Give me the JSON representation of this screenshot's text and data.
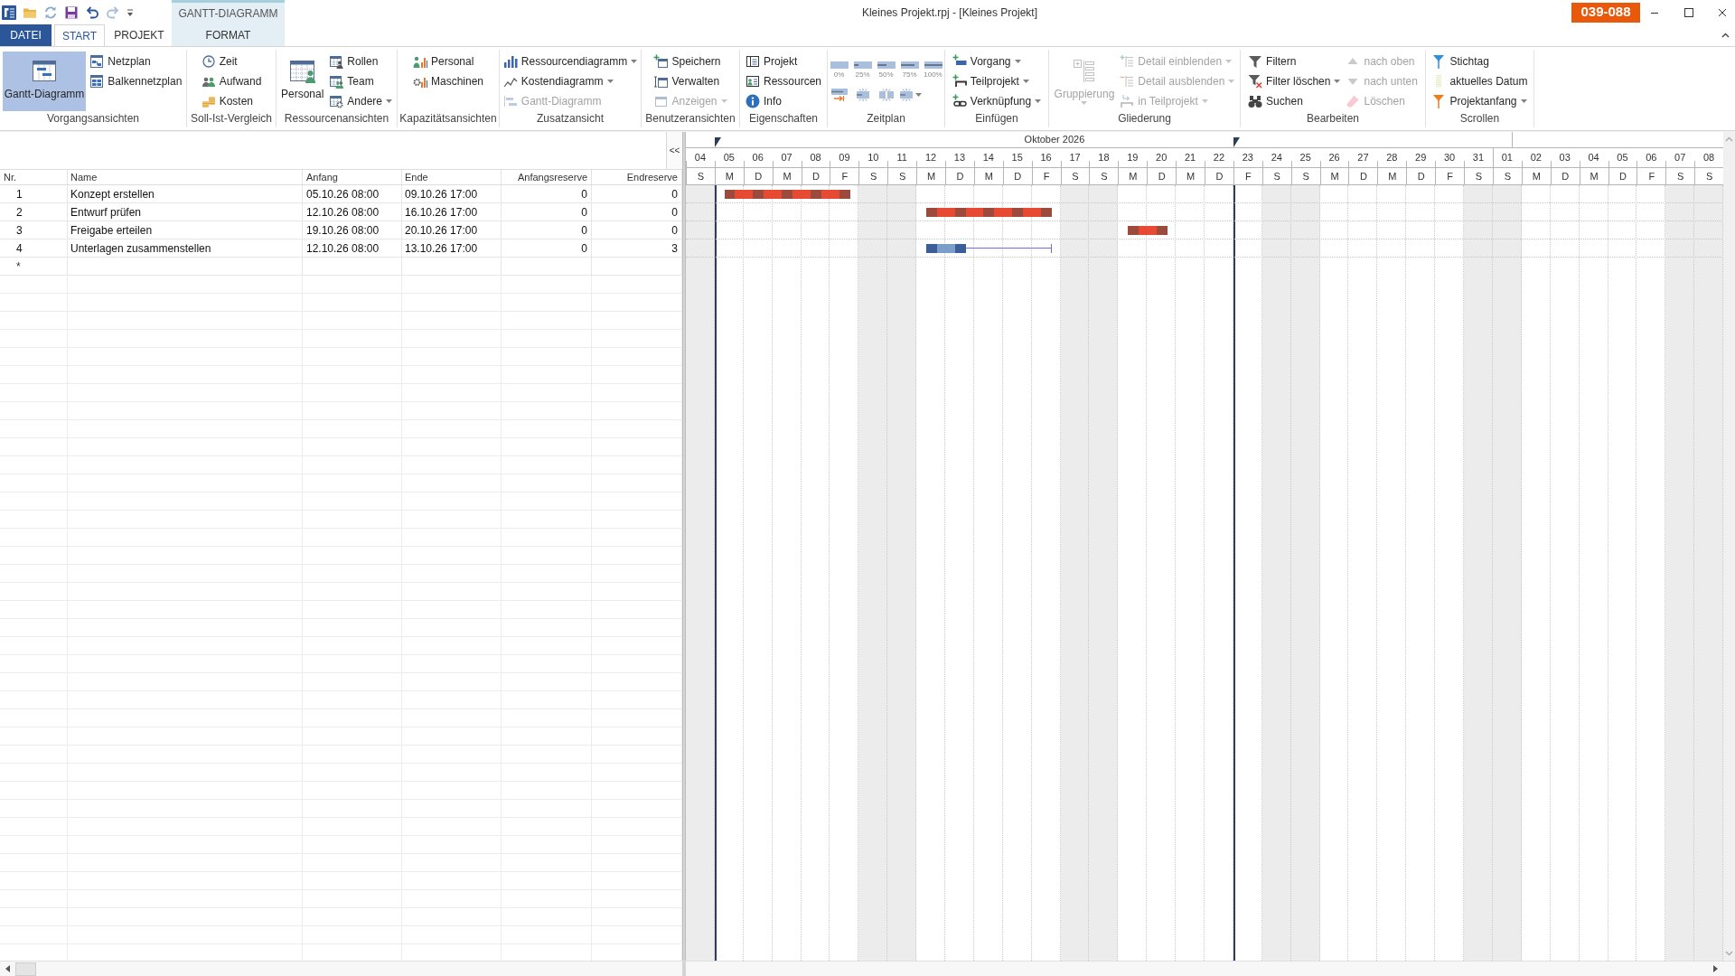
{
  "title_bar": {
    "context_tab_group": "GANTT-DIAGRAMM",
    "title": "Kleines Projekt.rpj - [Kleines Projekt]",
    "badge": "039-088"
  },
  "ribbon_tabs": [
    {
      "label": "DATEI",
      "kind": "file",
      "selected": false
    },
    {
      "label": "START",
      "kind": "tab",
      "selected": true
    },
    {
      "label": "PROJEKT",
      "kind": "tab",
      "selected": false
    },
    {
      "label": "FORMAT",
      "kind": "context",
      "selected": false
    }
  ],
  "ribbon_groups": [
    {
      "label": "Vorgangsansichten",
      "columns": [
        [
          {
            "label": "Gantt-Diagramm",
            "kind": "large",
            "selected": true,
            "disabled": false,
            "dropdown": false
          }
        ],
        [
          {
            "label": "Netzplan",
            "kind": "small",
            "selected": false,
            "disabled": false,
            "dropdown": false
          },
          {
            "label": "Balkennetzplan",
            "kind": "small",
            "selected": false,
            "disabled": false,
            "dropdown": false
          }
        ]
      ]
    },
    {
      "label": "Soll-Ist-Vergleich",
      "columns": [
        [
          {
            "label": "Zeit",
            "kind": "small",
            "disabled": false,
            "dropdown": false
          },
          {
            "label": "Aufwand",
            "kind": "small",
            "disabled": false,
            "dropdown": false
          },
          {
            "label": "Kosten",
            "kind": "small",
            "disabled": false,
            "dropdown": false
          }
        ]
      ]
    },
    {
      "label": "Ressourcenansichten",
      "columns": [
        [
          {
            "label": "Personal",
            "kind": "large",
            "disabled": false,
            "dropdown": false
          }
        ],
        [
          {
            "label": "Rollen",
            "kind": "small",
            "disabled": false,
            "dropdown": false
          },
          {
            "label": "Team",
            "kind": "small",
            "disabled": false,
            "dropdown": false
          },
          {
            "label": "Andere",
            "kind": "small",
            "disabled": false,
            "dropdown": true
          }
        ]
      ]
    },
    {
      "label": "Kapazitätsansichten",
      "columns": [
        [
          {
            "label": "Personal",
            "kind": "small",
            "disabled": false,
            "dropdown": false
          },
          {
            "label": "Maschinen",
            "kind": "small",
            "disabled": false,
            "dropdown": false
          }
        ]
      ]
    },
    {
      "label": "Zusatzansicht",
      "columns": [
        [
          {
            "label": "Ressourcendiagramm",
            "kind": "small",
            "disabled": false,
            "dropdown": true
          },
          {
            "label": "Kostendiagramm",
            "kind": "small",
            "disabled": false,
            "dropdown": true
          },
          {
            "label": "Gantt-Diagramm",
            "kind": "small",
            "disabled": true,
            "dropdown": false
          }
        ]
      ]
    },
    {
      "label": "Benutzeransichten",
      "columns": [
        [
          {
            "label": "Speichern",
            "kind": "small",
            "disabled": false,
            "dropdown": false
          },
          {
            "label": "Verwalten",
            "kind": "small",
            "disabled": false,
            "dropdown": false
          },
          {
            "label": "Anzeigen",
            "kind": "small",
            "disabled": true,
            "dropdown": true
          }
        ]
      ]
    },
    {
      "label": "Eigenschaften",
      "columns": [
        [
          {
            "label": "Projekt",
            "kind": "small",
            "disabled": false,
            "dropdown": false
          },
          {
            "label": "Ressourcen",
            "kind": "small",
            "disabled": false,
            "dropdown": false
          },
          {
            "label": "Info",
            "kind": "small",
            "disabled": false,
            "dropdown": false
          }
        ]
      ]
    },
    {
      "label": "Zeitplan",
      "columns": [
        [
          {
            "label": "0%",
            "kind": "percent",
            "disabled": false,
            "dropdown": false
          },
          {
            "kind": "icon",
            "disabled": false,
            "dropdown": false
          }
        ],
        [
          {
            "label": "25%",
            "kind": "percent",
            "disabled": false,
            "dropdown": false
          },
          {
            "kind": "icon",
            "disabled": false,
            "dropdown": false
          }
        ],
        [
          {
            "label": "50%",
            "kind": "percent",
            "disabled": false,
            "dropdown": false
          },
          {
            "kind": "icon",
            "disabled": false,
            "dropdown": false
          }
        ],
        [
          {
            "label": "75%",
            "kind": "percent",
            "disabled": false,
            "dropdown": false
          },
          {
            "kind": "icon",
            "disabled": false,
            "dropdown": true
          }
        ],
        [
          {
            "label": "100%",
            "kind": "percent",
            "disabled": false,
            "dropdown": false
          }
        ]
      ]
    },
    {
      "label": "Einfügen",
      "columns": [
        [
          {
            "label": "Vorgang",
            "kind": "small",
            "disabled": false,
            "dropdown": true
          },
          {
            "label": "Teilprojekt",
            "kind": "small",
            "disabled": false,
            "dropdown": true
          },
          {
            "label": "Verknüpfung",
            "kind": "small",
            "disabled": false,
            "dropdown": true
          }
        ]
      ]
    },
    {
      "label": "Gliederung",
      "columns": [
        [
          {
            "label": "Gruppierung",
            "kind": "large",
            "disabled": true,
            "dropdown": true
          }
        ],
        [
          {
            "label": "Detail einblenden",
            "kind": "small",
            "disabled": true,
            "dropdown": true
          },
          {
            "label": "Detail ausblenden",
            "kind": "small",
            "disabled": true,
            "dropdown": true
          },
          {
            "label": "in Teilprojekt",
            "kind": "small",
            "disabled": true,
            "dropdown": true
          }
        ]
      ]
    },
    {
      "label": "Bearbeiten",
      "columns": [
        [
          {
            "label": "Filtern",
            "kind": "small",
            "disabled": false,
            "dropdown": false
          },
          {
            "label": "Filter löschen",
            "kind": "small",
            "disabled": false,
            "dropdown": true
          },
          {
            "label": "Suchen",
            "kind": "small",
            "disabled": false,
            "dropdown": false
          }
        ],
        [
          {
            "label": "nach oben",
            "kind": "small",
            "disabled": true,
            "dropdown": false
          },
          {
            "label": "nach unten",
            "kind": "small",
            "disabled": true,
            "dropdown": false
          },
          {
            "label": "Löschen",
            "kind": "small",
            "disabled": true,
            "dropdown": false
          }
        ]
      ]
    },
    {
      "label": "Scrollen",
      "columns": [
        [
          {
            "label": "Stichtag",
            "kind": "small",
            "disabled": false,
            "dropdown": false
          },
          {
            "label": "aktuelles Datum",
            "kind": "small",
            "disabled": false,
            "dropdown": false
          },
          {
            "label": "Projektanfang",
            "kind": "small",
            "disabled": false,
            "dropdown": true
          }
        ]
      ]
    }
  ],
  "table": {
    "columns": [
      "Nr.",
      "Name",
      "Anfang",
      "Ende",
      "Anfangsreserve",
      "Endreserve"
    ],
    "rows": [
      {
        "nr": "1",
        "name": "Konzept erstellen",
        "start": "05.10.26 08:00",
        "end": "09.10.26 17:00",
        "start_reserve": "0",
        "end_reserve": "0",
        "critical": true
      },
      {
        "nr": "2",
        "name": "Entwurf prüfen",
        "start": "12.10.26 08:00",
        "end": "16.10.26 17:00",
        "start_reserve": "0",
        "end_reserve": "0",
        "critical": true
      },
      {
        "nr": "3",
        "name": "Freigabe erteilen",
        "start": "19.10.26 08:00",
        "end": "20.10.26 17:00",
        "start_reserve": "0",
        "end_reserve": "0",
        "critical": true
      },
      {
        "nr": "4",
        "name": "Unterlagen zusammenstellen",
        "start": "12.10.26 08:00",
        "end": "13.10.26 17:00",
        "start_reserve": "0",
        "end_reserve": "3",
        "critical": false
      }
    ],
    "new_row_marker": "*"
  },
  "gantt": {
    "collapse_button": "<<",
    "months": [
      {
        "label": "Oktober 2026",
        "days": [
          {
            "day": "04",
            "weekday": "S",
            "weekend": true,
            "marker": false
          },
          {
            "day": "05",
            "weekday": "M",
            "weekend": false,
            "marker": true
          },
          {
            "day": "06",
            "weekday": "D",
            "weekend": false,
            "marker": false
          },
          {
            "day": "07",
            "weekday": "M",
            "weekend": false,
            "marker": false
          },
          {
            "day": "08",
            "weekday": "D",
            "weekend": false,
            "marker": false
          },
          {
            "day": "09",
            "weekday": "F",
            "weekend": false,
            "marker": false
          },
          {
            "day": "10",
            "weekday": "S",
            "weekend": true,
            "marker": false
          },
          {
            "day": "11",
            "weekday": "S",
            "weekend": true,
            "marker": false
          },
          {
            "day": "12",
            "weekday": "M",
            "weekend": false,
            "marker": false
          },
          {
            "day": "13",
            "weekday": "D",
            "weekend": false,
            "marker": false
          },
          {
            "day": "14",
            "weekday": "M",
            "weekend": false,
            "marker": false
          },
          {
            "day": "15",
            "weekday": "D",
            "weekend": false,
            "marker": false
          },
          {
            "day": "16",
            "weekday": "F",
            "weekend": false,
            "marker": false
          },
          {
            "day": "17",
            "weekday": "S",
            "weekend": true,
            "marker": false
          },
          {
            "day": "18",
            "weekday": "S",
            "weekend": true,
            "marker": false
          },
          {
            "day": "19",
            "weekday": "M",
            "weekend": false,
            "marker": false
          },
          {
            "day": "20",
            "weekday": "D",
            "weekend": false,
            "marker": false
          },
          {
            "day": "21",
            "weekday": "M",
            "weekend": false,
            "marker": false
          },
          {
            "day": "22",
            "weekday": "D",
            "weekend": false,
            "marker": false
          },
          {
            "day": "23",
            "weekday": "F",
            "weekend": false,
            "marker": true
          },
          {
            "day": "24",
            "weekday": "S",
            "weekend": true,
            "marker": false
          },
          {
            "day": "25",
            "weekday": "S",
            "weekend": true,
            "marker": false
          },
          {
            "day": "26",
            "weekday": "M",
            "weekend": false,
            "marker": false
          },
          {
            "day": "27",
            "weekday": "D",
            "weekend": false,
            "marker": false
          },
          {
            "day": "28",
            "weekday": "M",
            "weekend": false,
            "marker": false
          },
          {
            "day": "29",
            "weekday": "D",
            "weekend": false,
            "marker": false
          },
          {
            "day": "30",
            "weekday": "F",
            "weekend": false,
            "marker": false
          },
          {
            "day": "31",
            "weekday": "S",
            "weekend": true,
            "marker": false
          }
        ]
      },
      {
        "days": [
          {
            "day": "01",
            "weekday": "S",
            "weekend": true,
            "marker": false
          },
          {
            "day": "02",
            "weekday": "M",
            "weekend": false,
            "marker": false
          },
          {
            "day": "03",
            "weekday": "D",
            "weekend": false,
            "marker": false
          },
          {
            "day": "04",
            "weekday": "M",
            "weekend": false,
            "marker": false
          },
          {
            "day": "05",
            "weekday": "D",
            "weekend": false,
            "marker": false
          },
          {
            "day": "06",
            "weekday": "F",
            "weekend": false,
            "marker": false
          },
          {
            "day": "07",
            "weekday": "S",
            "weekend": true,
            "marker": false
          },
          {
            "day": "08",
            "weekday": "S",
            "weekend": true,
            "marker": false
          }
        ]
      }
    ]
  }
}
